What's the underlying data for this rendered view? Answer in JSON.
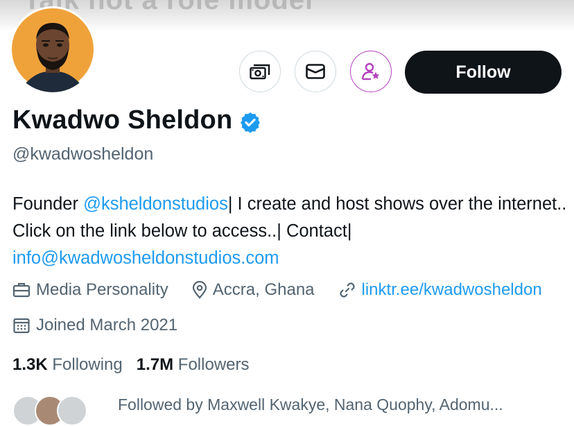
{
  "profile": {
    "banner_text": "Talk not a role model",
    "display_name": "Kwadwo Sheldon",
    "handle": "@kwadwosheldon",
    "verified_color": "#1d9bf0",
    "bio": {
      "part1": "Founder ",
      "mention": "@ksheldonstudios",
      "part2": "| I create and host shows over the internet.. Click on the link below to access..| Contact|",
      "email": "info@kwadwosheldonstudios.com"
    },
    "category": "Media Personality",
    "location": "Accra, Ghana",
    "website": "linktr.ee/kwadwosheldon",
    "joined": "Joined March 2021",
    "following_count": "1.3K",
    "following_label": "Following",
    "followers_count": "1.7M",
    "followers_label": "Followers",
    "followed_by_text": "Followed by Maxwell Kwakye, Nana Quophy, Adomu..."
  },
  "actions": {
    "follow_label": "Follow",
    "icons": [
      "money-icon",
      "mail-icon",
      "subscribe-star-icon"
    ]
  },
  "colors": {
    "link": "#1d9bf0",
    "subscribe": "#b43fbf",
    "follow_bg": "#0f1419",
    "secondary_text": "#536471"
  }
}
